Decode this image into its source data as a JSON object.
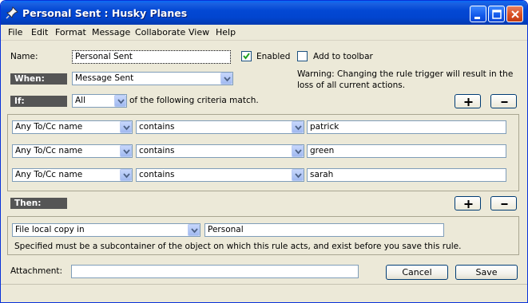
{
  "window": {
    "title": "Personal Sent : Husky Planes",
    "icon": "pin-icon"
  },
  "menu": [
    "File",
    "Edit",
    "Format",
    "Message",
    "Collaborate",
    "View",
    "Help"
  ],
  "name_row": {
    "label": "Name:",
    "value": "Personal Sent",
    "enabled_label": "Enabled",
    "enabled_checked": true,
    "toolbar_label": "Add to toolbar",
    "toolbar_checked": false
  },
  "when": {
    "label": "When:",
    "value": "Message Sent",
    "warning": [
      "Warning:  Changing the rule trigger will result in the",
      "loss of all current actions."
    ]
  },
  "if": {
    "label": "If:",
    "match_value": "All",
    "match_text": "of the following criteria match.",
    "criteria": [
      {
        "field": "Any To/Cc name",
        "op": "contains",
        "value": "patrick"
      },
      {
        "field": "Any To/Cc name",
        "op": "contains",
        "value": "green"
      },
      {
        "field": "Any To/Cc name",
        "op": "contains",
        "value": "sarah"
      }
    ]
  },
  "then": {
    "label": "Then:",
    "action": "File local copy in",
    "value": "Personal",
    "note": "Specified must be a subcontainer of the object on which this rule acts, and  exist before you save this rule."
  },
  "attachment": {
    "label": "Attachment:",
    "value": ""
  },
  "buttons": {
    "cancel": "Cancel",
    "save": "Save"
  }
}
